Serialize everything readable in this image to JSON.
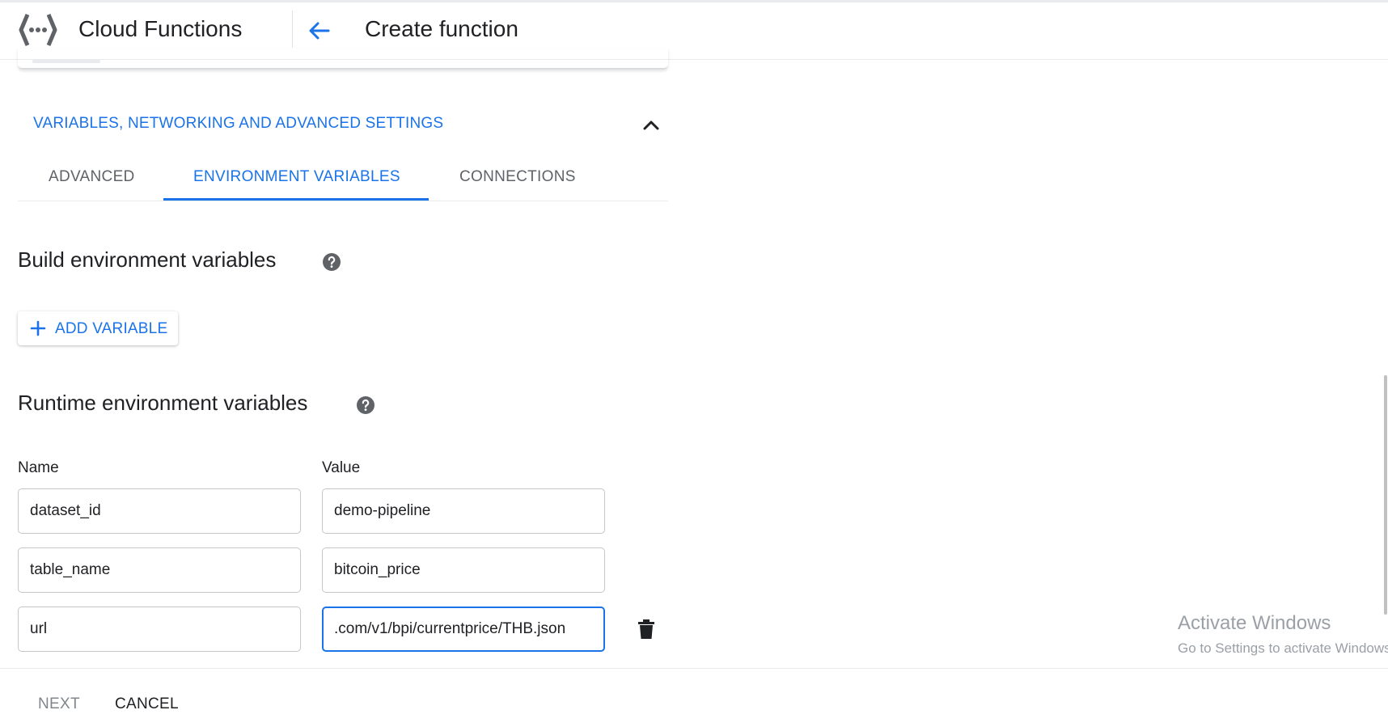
{
  "header": {
    "product_name": "Cloud Functions",
    "page_title": "Create function"
  },
  "section": {
    "title": "VARIABLES, NETWORKING AND ADVANCED SETTINGS"
  },
  "tabs": [
    {
      "label": "ADVANCED",
      "active": false
    },
    {
      "label": "ENVIRONMENT VARIABLES",
      "active": true
    },
    {
      "label": "CONNECTIONS",
      "active": false
    }
  ],
  "build_env": {
    "heading": "Build environment variables",
    "add_label": "ADD VARIABLE"
  },
  "runtime_env": {
    "heading": "Runtime environment variables",
    "name_label": "Name",
    "value_label": "Value",
    "rows": [
      {
        "name": "dataset_id",
        "value": "demo-pipeline"
      },
      {
        "name": "table_name",
        "value": "bitcoin_price"
      },
      {
        "name": "url",
        "value": ".com/v1/bpi/currentprice/THB.json"
      }
    ]
  },
  "footer": {
    "next_label": "NEXT",
    "cancel_label": "CANCEL"
  },
  "watermark": {
    "title": "Activate Windows",
    "subtitle": "Go to Settings to activate Windows."
  },
  "colors": {
    "accent": "#1a73e8",
    "text": "#202124",
    "muted": "#5f6368",
    "disabled": "#80868b"
  }
}
